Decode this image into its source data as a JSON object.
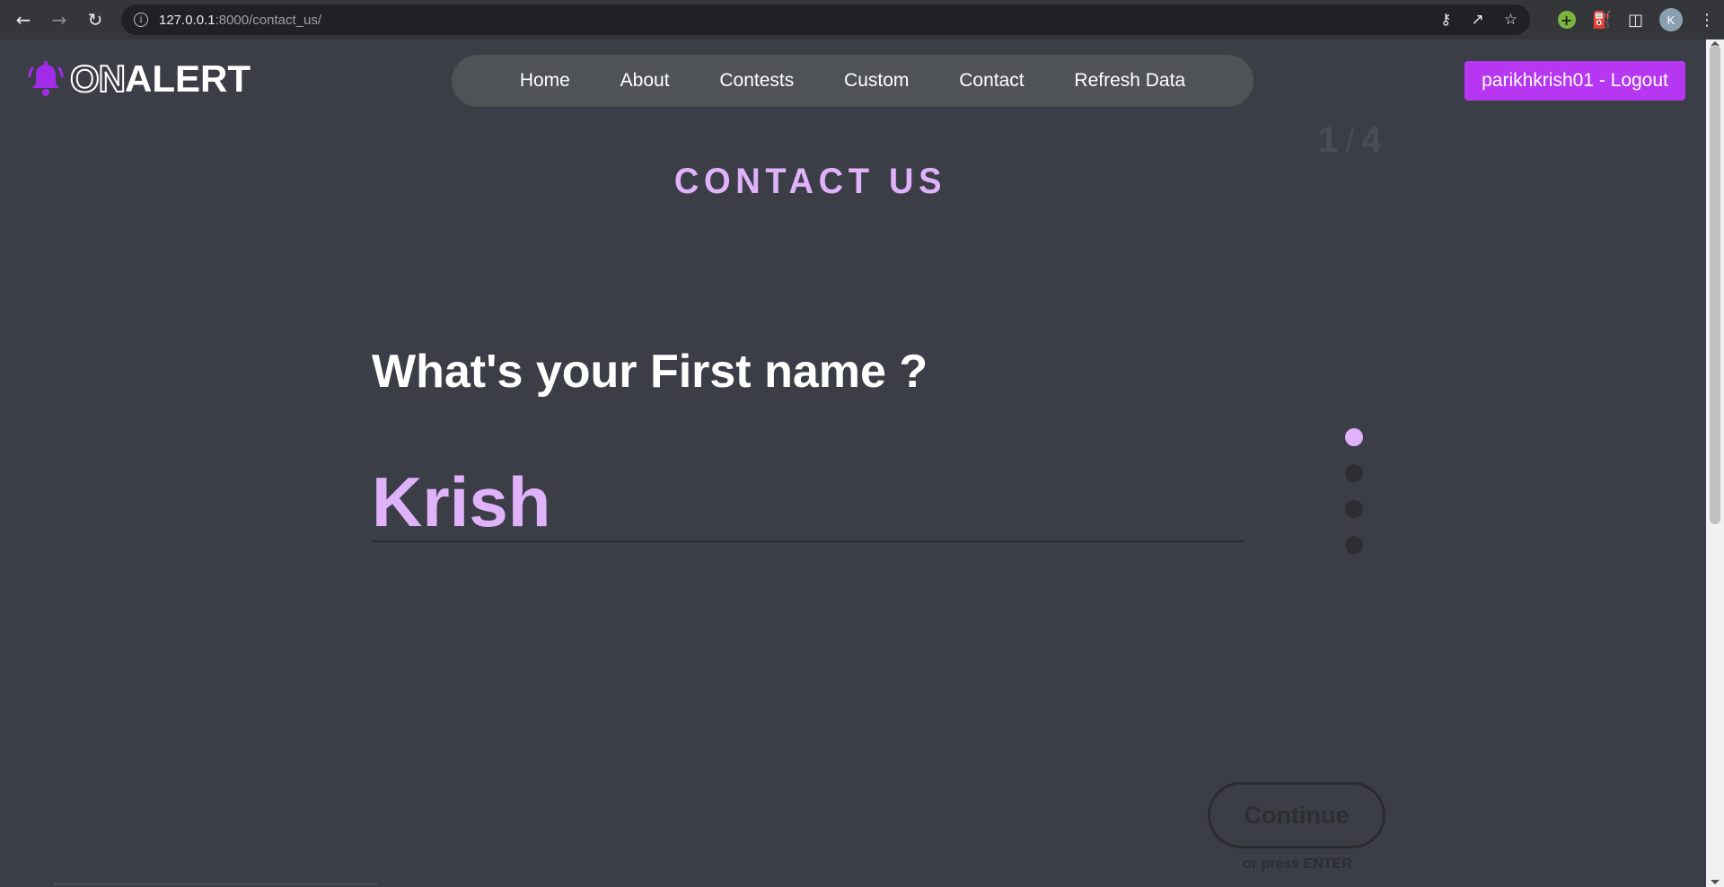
{
  "browser": {
    "url_host": "127.0.0.1",
    "url_rest": ":8000/contact_us/",
    "profile_initial": "K"
  },
  "site": {
    "logo_on": "ON",
    "logo_alert": "ALERT",
    "nav": [
      "Home",
      "About",
      "Contests",
      "Custom",
      "Contact",
      "Refresh Data"
    ],
    "logout_label": "parikhkrish01 - Logout",
    "brand_color": "#b636f2",
    "accent_color": "#e0b2fa"
  },
  "form": {
    "title": "CONTACT US",
    "step_current": "1",
    "step_separator": "/",
    "step_total": "4",
    "question": "What's your First name ?",
    "answer_value": "Krish",
    "steps_count": 4,
    "active_step": 1,
    "continue_label": "Continue",
    "hint": "or press ENTER"
  }
}
